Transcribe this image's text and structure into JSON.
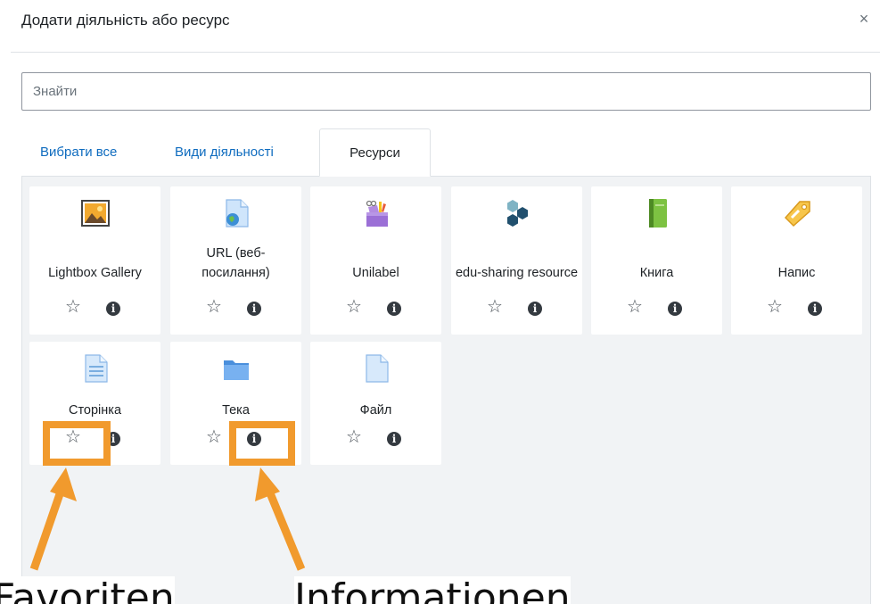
{
  "dialog": {
    "title": "Додати діяльність або ресурс",
    "close_glyph": "×"
  },
  "search": {
    "placeholder": "Знайти",
    "value": ""
  },
  "tabs": [
    {
      "label": "Вибрати все",
      "active": false
    },
    {
      "label": "Види діяльності",
      "active": false
    },
    {
      "label": "Ресурси",
      "active": true
    }
  ],
  "modules": [
    {
      "label": "Lightbox Gallery",
      "icon": "image-gallery-icon"
    },
    {
      "label": "URL (веб-посилання)",
      "icon": "url-link-icon"
    },
    {
      "label": "Unilabel",
      "icon": "unilabel-icon"
    },
    {
      "label": "edu-sharing resource",
      "icon": "edu-sharing-icon"
    },
    {
      "label": "Книга",
      "icon": "book-icon"
    },
    {
      "label": "Напис",
      "icon": "label-tag-icon"
    },
    {
      "label": "Сторінка",
      "icon": "page-icon"
    },
    {
      "label": "Тека",
      "icon": "folder-icon"
    },
    {
      "label": "Файл",
      "icon": "file-icon"
    }
  ],
  "card_actions": {
    "star_glyph": "☆",
    "info_glyph": "i"
  },
  "annotations": {
    "favorites": "Favoriten",
    "information": "Informationen",
    "color": "#f19a2d"
  },
  "colors": {
    "link": "#0f6cbf",
    "panel_bg": "#f1f3f5",
    "highlight": "#f19a2d"
  }
}
